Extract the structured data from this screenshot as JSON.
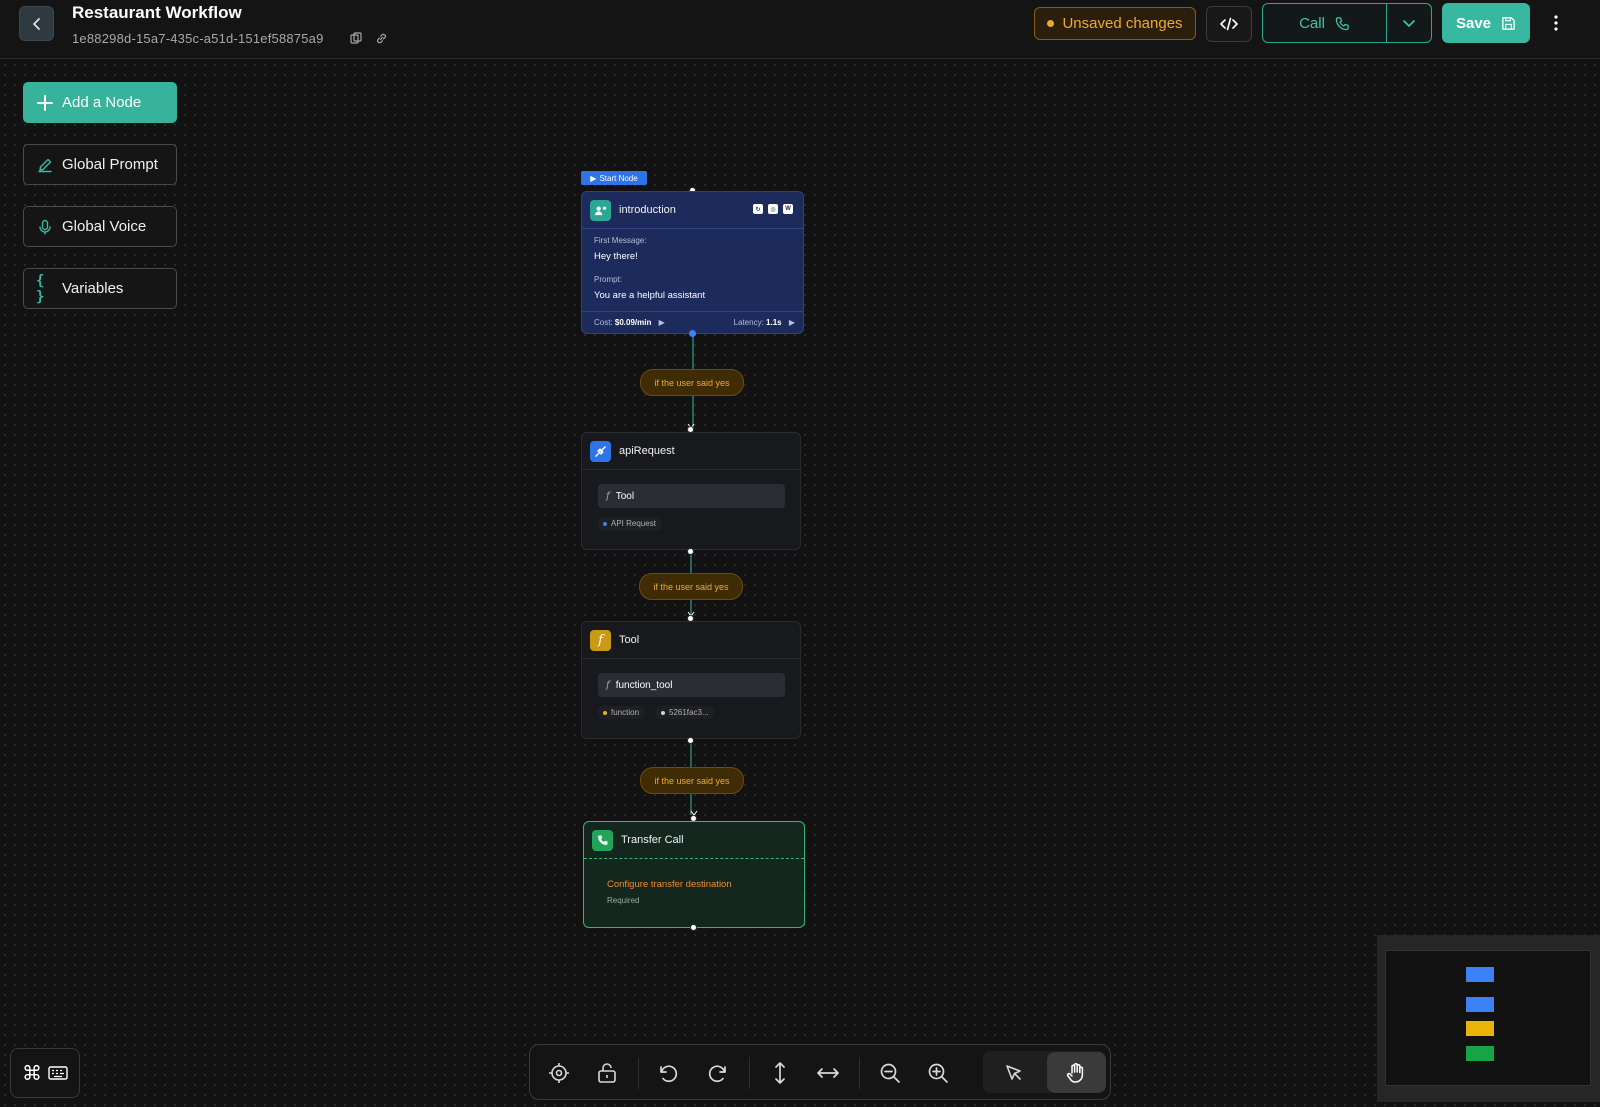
{
  "header": {
    "title": "Restaurant Workflow",
    "workflow_id": "1e88298d-15a7-435c-a51d-151ef58875a9",
    "unsaved_label": "Unsaved changes",
    "call_label": "Call",
    "save_label": "Save"
  },
  "sidebar": {
    "add_node": "Add a Node",
    "global_prompt": "Global Prompt",
    "global_voice": "Global Voice",
    "variables": "Variables"
  },
  "nodes": {
    "start_badge": "Start Node",
    "introduction": {
      "title": "introduction",
      "first_message_label": "First Message:",
      "first_message": "Hey there!",
      "prompt_label": "Prompt:",
      "prompt": "You are a helpful assistant",
      "cost_label": "Cost:",
      "cost": "$0.09/min",
      "latency_label": "Latency:",
      "latency": "1.1s"
    },
    "api_request": {
      "title": "apiRequest",
      "tool_label": "Tool",
      "chip": "API Request"
    },
    "tool": {
      "title": "Tool",
      "tool_label": "function_tool",
      "chip_type": "function",
      "chip_id": "5261fac3..."
    },
    "transfer": {
      "title": "Transfer Call",
      "warning": "Configure transfer destination",
      "required": "Required"
    }
  },
  "edges": [
    {
      "condition": "if the user said yes"
    },
    {
      "condition": "if the user said yes"
    },
    {
      "condition": "if the user said yes"
    }
  ],
  "colors": {
    "accent": "#38b8a0",
    "warning": "#f0a92e",
    "start_node": "#1c2a5c",
    "transfer_border": "#38b56e"
  },
  "icons": {
    "back": "chevron-left-icon",
    "copy": "copy-icon",
    "link": "link-icon",
    "code": "code-icon",
    "phone": "phone-icon",
    "save": "save-icon",
    "more": "more-vertical-icon"
  },
  "minimap": {
    "node_colors": [
      "#3b82f6",
      "#3b82f6",
      "#eab308",
      "#16a34a"
    ]
  }
}
